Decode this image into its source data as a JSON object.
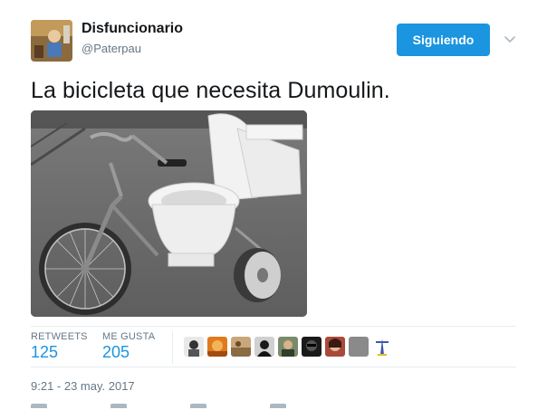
{
  "user": {
    "display_name": "Disfuncionario",
    "handle": "@Paterpau",
    "avatar_icon": "user-avatar"
  },
  "follow_button": {
    "label": "Siguiendo",
    "color": "#1b95e0"
  },
  "menu": {
    "icon": "chevron-down-icon"
  },
  "tweet": {
    "text": "La bicicleta que necesita Dumoulin.",
    "media_icon": "photo-toilet-bicycle"
  },
  "stats": {
    "retweets_label": "RETWEETS",
    "retweets_value": "125",
    "likes_label": "ME GUSTA",
    "likes_value": "205",
    "liker_avatar_count": 9
  },
  "timestamp": "9:21 - 23 may. 2017",
  "colors": {
    "accent": "#1b95e0",
    "secondary_text": "#657786",
    "divider": "#e6ecf0"
  }
}
